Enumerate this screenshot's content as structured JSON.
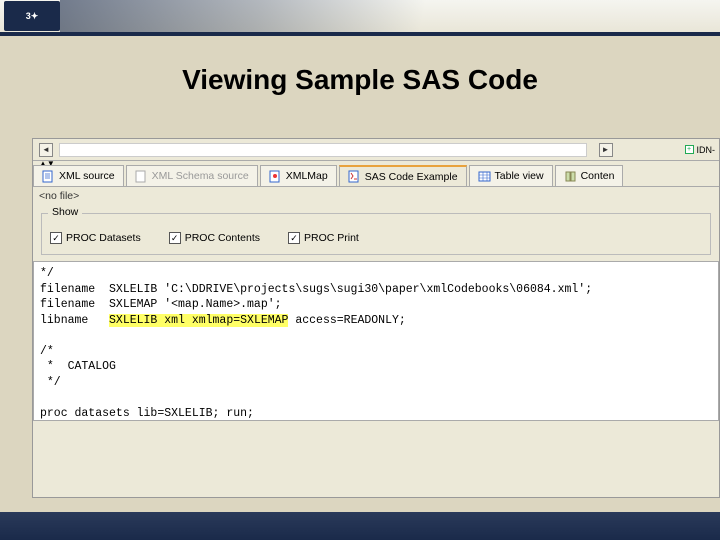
{
  "header": {
    "logo_text": "3✦"
  },
  "title": "Viewing Sample SAS Code",
  "upper": {
    "right_items": [
      "IDN-"
    ]
  },
  "tabs": [
    {
      "label": "XML source",
      "active": false,
      "dim": false
    },
    {
      "label": "XML Schema source",
      "active": false,
      "dim": true
    },
    {
      "label": "XMLMap",
      "active": false,
      "dim": false
    },
    {
      "label": "SAS Code Example",
      "active": true,
      "dim": false
    },
    {
      "label": "Table view",
      "active": false,
      "dim": false
    },
    {
      "label": "Conten",
      "active": false,
      "dim": false
    }
  ],
  "nofile": "<no file>",
  "show": {
    "legend": "Show",
    "options": [
      {
        "label": "PROC Datasets",
        "checked": true
      },
      {
        "label": "PROC Contents",
        "checked": true
      },
      {
        "label": "PROC Print",
        "checked": true
      }
    ]
  },
  "code": {
    "l1": "*/",
    "l2": "filename  SXLELIB 'C:\\DDRIVE\\projects\\sugs\\sugi30\\paper\\xmlCodebooks\\06084.xml';",
    "l3": "filename  SXLEMAP '<map.Name>.map';",
    "l4a": "libname   ",
    "l4b": "SXLELIB xml xmlmap=SXLEMAP",
    "l4c": " access=READONLY;",
    "l5": "",
    "l6": "/*",
    "l7": " *  CATALOG",
    "l8": " */",
    "l9": "",
    "l10": "proc datasets lib=SXLELIB; run;"
  }
}
